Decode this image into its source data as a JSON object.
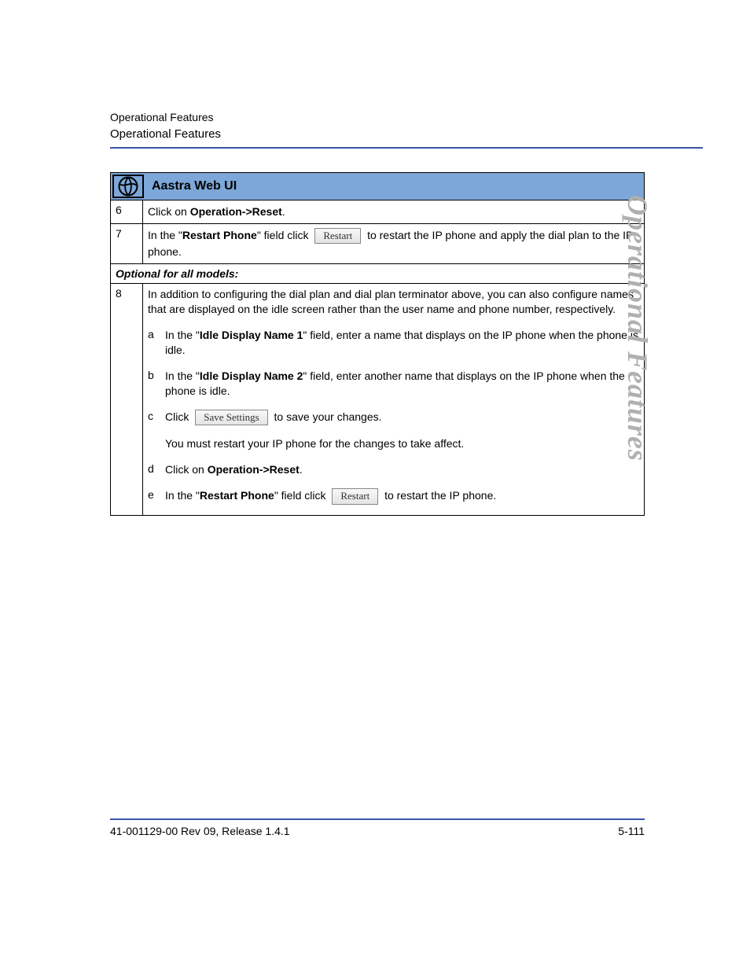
{
  "header": {
    "line1": "Operational Features",
    "line2": "Operational Features"
  },
  "side_title": "Operational Features",
  "section_title": "Aastra Web UI",
  "rows": {
    "r6": {
      "num": "6",
      "pre": "Click on ",
      "bold": "Operation->Reset",
      "post": "."
    },
    "r7": {
      "num": "7",
      "pre": "In the \"",
      "bold": "Restart Phone",
      "mid": "\" field click ",
      "btn": "Restart",
      "post": " to restart the IP phone and apply the dial plan to the IP phone."
    }
  },
  "optional_heading": "Optional for all models:",
  "r8": {
    "num": "8",
    "intro": "In addition to configuring the dial plan and dial plan terminator above, you can also configure names that are displayed on the idle screen rather than the user name and phone number, respectively.",
    "items": {
      "a": {
        "label": "a",
        "pre": "In the \"",
        "bold": "Idle Display Name 1",
        "post": "\" field, enter a name that displays on the IP phone when the phone is idle."
      },
      "b": {
        "label": "b",
        "pre": "In the \"",
        "bold": "Idle Display Name 2",
        "post": "\" field, enter another name that displays on the IP phone when the phone is idle."
      },
      "c": {
        "label": "c",
        "pre": "Click ",
        "btn": "Save Settings",
        "post": " to save your changes.",
        "extra": "You must restart your IP phone for the changes to take affect."
      },
      "d": {
        "label": "d",
        "pre": "Click on ",
        "bold": "Operation->Reset",
        "post": "."
      },
      "e": {
        "label": "e",
        "pre": "In the \"",
        "bold": "Restart Phone",
        "mid": "\" field click ",
        "btn": "Restart",
        "post": " to restart the IP phone."
      }
    }
  },
  "footer": {
    "left": "41-001129-00 Rev 09, Release 1.4.1",
    "right": "5-111"
  }
}
